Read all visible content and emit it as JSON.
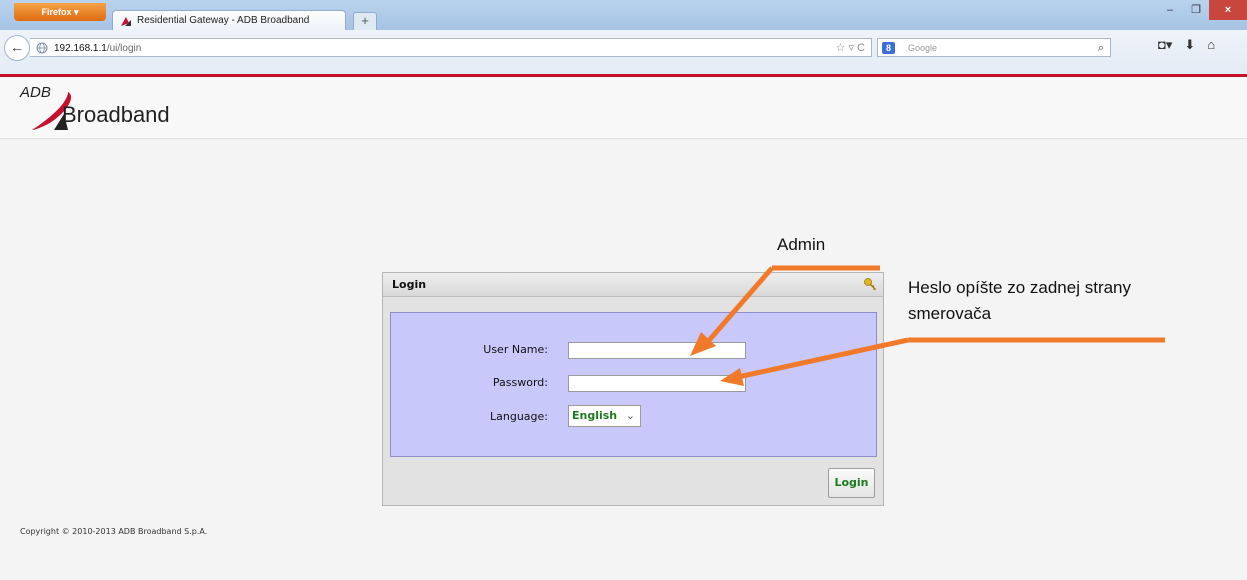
{
  "browser": {
    "app_button": "Firefox ▾",
    "tab_title": "Residential Gateway - ADB Broadband",
    "new_tab": "+",
    "url_host": "192.168.1.1",
    "url_path": "/ui/login",
    "url_tools": "☆ ▿ C",
    "search_engine_badge": "8",
    "search_placeholder": "Google",
    "window_controls": {
      "minimize": "–",
      "maximize": "❐",
      "close": "×"
    },
    "nav": {
      "back": "←",
      "bookmarks": "◘▾",
      "downloads": "⬇",
      "home": "⌂"
    }
  },
  "page": {
    "logo": {
      "top": "ADB",
      "bottom": "Broadband"
    },
    "login": {
      "title": "Login",
      "username_label": "User Name:",
      "password_label": "Password:",
      "language_label": "Language:",
      "username_value": "",
      "password_value": "",
      "language_value": "English",
      "submit": "Login"
    },
    "copyright": "Copyright © 2010-2013 ADB Broadband S.p.A."
  },
  "annotations": {
    "admin": "Admin",
    "password_hint": "Heslo opíšte zo zadnej strany smerovača",
    "arrow_color": "#f07a2a"
  }
}
